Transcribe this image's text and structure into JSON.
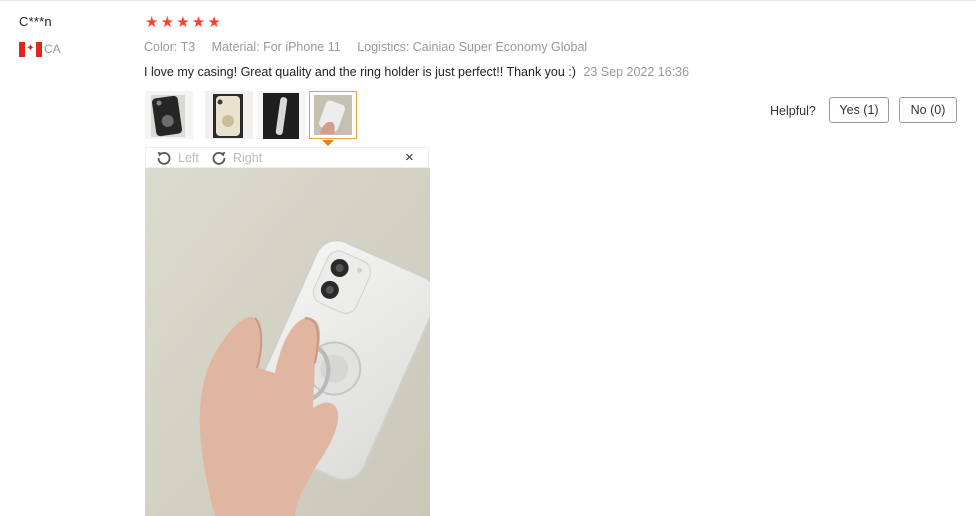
{
  "review": {
    "user": "C***n",
    "country": "CA",
    "rating": 5,
    "stars": [
      "★",
      "★",
      "★",
      "★",
      "★"
    ],
    "attributes": [
      {
        "key": "Color:",
        "value": "T3"
      },
      {
        "key": "Material:",
        "value": "For iPhone 11"
      },
      {
        "key": "Logistics:",
        "value": "Cainiao Super Economy Global"
      }
    ],
    "text": "I love my casing! Great quality and the ring holder is just perfect!! Thank you :)",
    "date": "23 Sep 2022 16:36"
  },
  "helpful": {
    "label": "Helpful?",
    "yes_label": "Yes (1)",
    "no_label": "No (0)"
  },
  "viewer": {
    "rotate_left": "Left",
    "rotate_right": "Right",
    "close_icon": "×"
  },
  "colors": {
    "star": "#f44336",
    "active_thumb_border": "#e6a23c",
    "muted_text": "#999999"
  }
}
